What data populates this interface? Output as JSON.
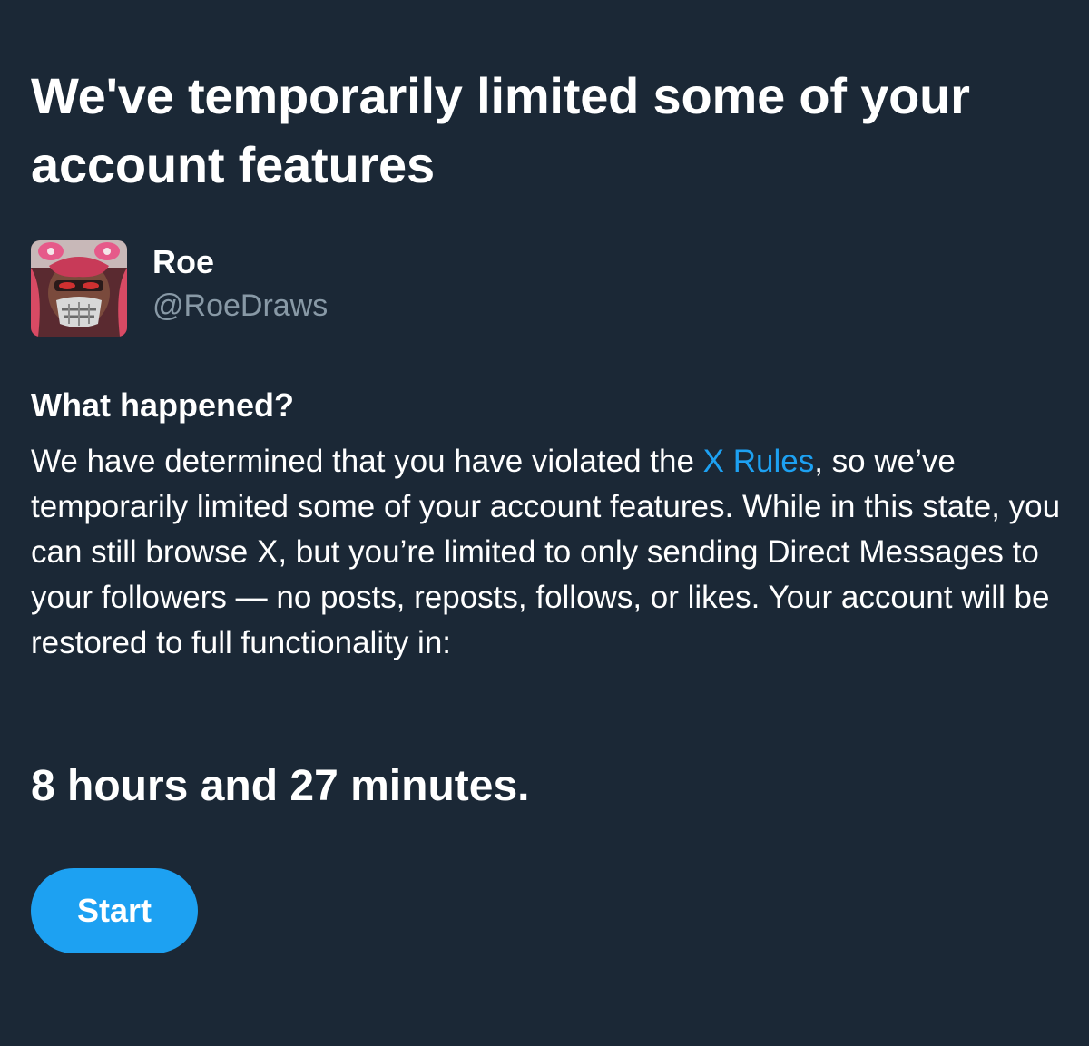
{
  "header": {
    "title": "We've temporarily limited some of your account features"
  },
  "account": {
    "display_name": "Roe",
    "handle": "@RoeDraws",
    "avatar_icon": "user-avatar-icon"
  },
  "notice": {
    "heading": "What happened?",
    "text_before_link": "We have determined that you have violated the ",
    "link_label": "X Rules",
    "text_after_link": ", so we’ve temporarily limited some of your account features. While in this state, you can still browse X, but you’re limited to only sending Direct Messages to your followers — no posts, reposts, follows, or likes. Your account will be restored to full functionality in:",
    "countdown": "8 hours and 27 minutes."
  },
  "actions": {
    "start_label": "Start"
  },
  "colors": {
    "background": "#1b2836",
    "text": "#ffffff",
    "muted": "#8899a6",
    "accent": "#1da1f2"
  }
}
